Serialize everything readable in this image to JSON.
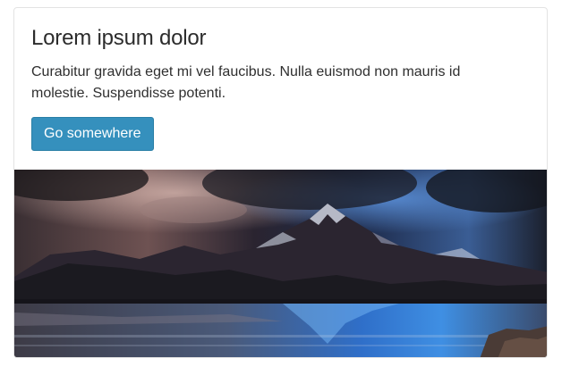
{
  "card": {
    "title": "Lorem ipsum dolor",
    "text": "Curabitur gravida eget mi vel faucibus. Nulla euismod non mauris id molestie. Suspendisse potenti.",
    "button_label": "Go somewhere",
    "image_subject": "mountain-lake-landscape"
  },
  "colors": {
    "button_bg": "#3590bd",
    "button_text": "#ffffff",
    "title_text": "#2c2c2c",
    "body_text": "#2f2f2f"
  }
}
